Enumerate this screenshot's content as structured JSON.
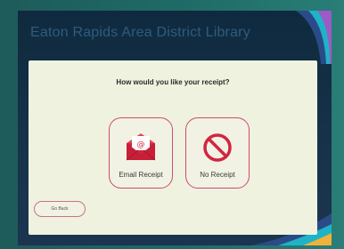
{
  "header": {
    "title": "Eaton Rapids Area District Library"
  },
  "dialog": {
    "prompt": "How would you like your receipt?",
    "options": [
      {
        "label": "Email Receipt",
        "icon": "email-envelope-icon"
      },
      {
        "label": "No Receipt",
        "icon": "prohibited-icon"
      }
    ],
    "back_label": "Go Back"
  },
  "colors": {
    "accent": "#d04a6e",
    "dialog_bg": "#eef2df",
    "screen_bg": "#17334a",
    "bezel": "#1f6b68"
  }
}
